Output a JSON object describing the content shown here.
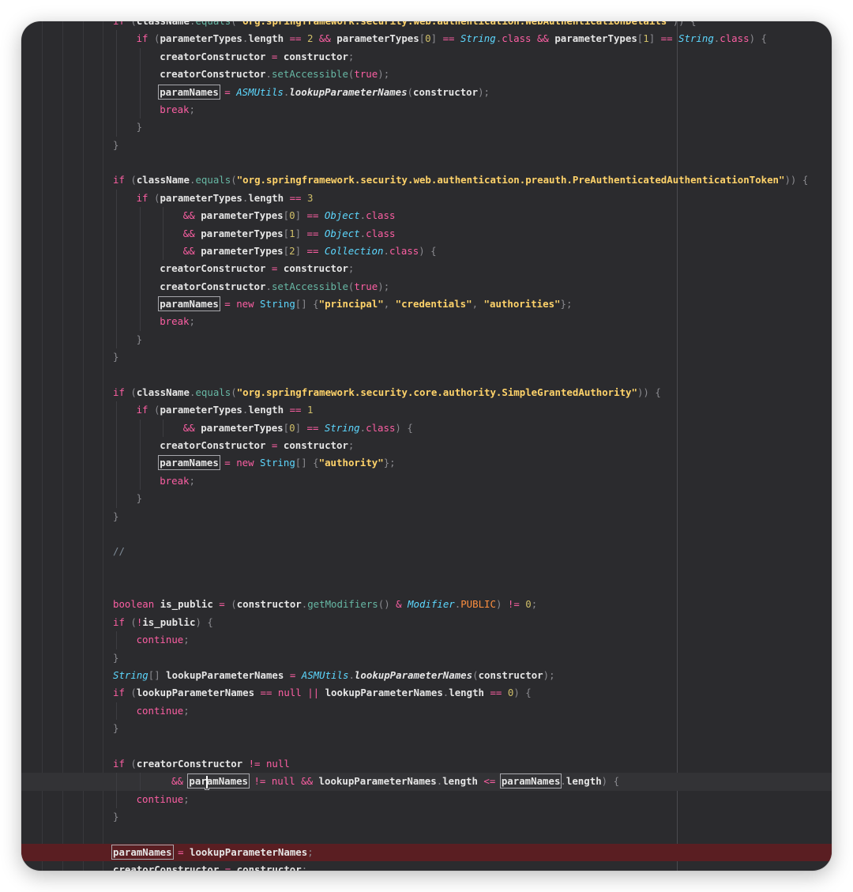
{
  "editor": {
    "colors": {
      "background": "#2b2b2e",
      "keyword": "#fc5fa3",
      "method": "#67b7a4",
      "string": "#ffd36a",
      "type": "#5dd8ff",
      "error_line": "#5a1e22"
    },
    "lines": [
      {
        "indent": 0,
        "tokens": [
          [
            "kw",
            "if"
          ],
          [
            "punct",
            " ("
          ],
          [
            "ident",
            "className"
          ],
          [
            "punct",
            "."
          ],
          [
            "fn",
            "equals"
          ],
          [
            "punct",
            "("
          ],
          [
            "strw",
            "\"org.springframework.security.web.authentication.WebAuthenticationDetails\""
          ],
          [
            "punct",
            "))"
          ],
          [
            "punct",
            " {"
          ]
        ]
      },
      {
        "indent": 1,
        "tokens": [
          [
            "kw",
            "if"
          ],
          [
            "punct",
            " ("
          ],
          [
            "ident",
            "parameterTypes"
          ],
          [
            "punct",
            "."
          ],
          [
            "ident",
            "length"
          ],
          [
            "op",
            " == "
          ],
          [
            "num",
            "2"
          ],
          [
            "op",
            " && "
          ],
          [
            "ident",
            "parameterTypes"
          ],
          [
            "punct",
            "["
          ],
          [
            "num",
            "0"
          ],
          [
            "punct",
            "]"
          ],
          [
            "op",
            " == "
          ],
          [
            "type",
            "String"
          ],
          [
            "punct",
            "."
          ],
          [
            "kw",
            "class"
          ],
          [
            "op",
            " && "
          ],
          [
            "ident",
            "parameterTypes"
          ],
          [
            "punct",
            "["
          ],
          [
            "num",
            "1"
          ],
          [
            "punct",
            "]"
          ],
          [
            "op",
            " == "
          ],
          [
            "type",
            "String"
          ],
          [
            "punct",
            "."
          ],
          [
            "kw",
            "class"
          ],
          [
            "punct",
            ") {"
          ]
        ]
      },
      {
        "indent": 2,
        "tokens": [
          [
            "ident",
            "creatorConstructor"
          ],
          [
            "op",
            " = "
          ],
          [
            "ident",
            "constructor"
          ],
          [
            "punct",
            ";"
          ]
        ]
      },
      {
        "indent": 2,
        "tokens": [
          [
            "ident",
            "creatorConstructor"
          ],
          [
            "punct",
            "."
          ],
          [
            "fn",
            "setAccessible"
          ],
          [
            "punct",
            "("
          ],
          [
            "kw",
            "true"
          ],
          [
            "punct",
            ");"
          ]
        ]
      },
      {
        "indent": 2,
        "tokens": [
          [
            "hl",
            "paramNames"
          ],
          [
            "op",
            " = "
          ],
          [
            "type",
            "ASMUtils"
          ],
          [
            "punct",
            "."
          ],
          [
            "typei",
            "lookupParameterNames"
          ],
          [
            "punct",
            "("
          ],
          [
            "ident",
            "constructor"
          ],
          [
            "punct",
            ");"
          ]
        ]
      },
      {
        "indent": 2,
        "tokens": [
          [
            "kw",
            "break"
          ],
          [
            "punct",
            ";"
          ]
        ]
      },
      {
        "indent": 1,
        "tokens": [
          [
            "punct",
            "}"
          ]
        ]
      },
      {
        "indent": 0,
        "tokens": [
          [
            "punct",
            "}"
          ]
        ]
      },
      {
        "indent": 0,
        "tokens": []
      },
      {
        "indent": 0,
        "tokens": [
          [
            "kw",
            "if"
          ],
          [
            "punct",
            " ("
          ],
          [
            "ident",
            "className"
          ],
          [
            "punct",
            "."
          ],
          [
            "fn",
            "equals"
          ],
          [
            "punct",
            "("
          ],
          [
            "strw",
            "\"org.springframework.security.web.authentication.preauth.PreAuthenticatedAuthenticationToken\""
          ],
          [
            "punct",
            "))"
          ],
          [
            "punct",
            " {"
          ]
        ]
      },
      {
        "indent": 1,
        "tokens": [
          [
            "kw",
            "if"
          ],
          [
            "punct",
            " ("
          ],
          [
            "ident",
            "parameterTypes"
          ],
          [
            "punct",
            "."
          ],
          [
            "ident",
            "length"
          ],
          [
            "op",
            " == "
          ],
          [
            "num",
            "3"
          ]
        ]
      },
      {
        "indent": 3,
        "tokens": [
          [
            "op",
            "&& "
          ],
          [
            "ident",
            "parameterTypes"
          ],
          [
            "punct",
            "["
          ],
          [
            "num",
            "0"
          ],
          [
            "punct",
            "]"
          ],
          [
            "op",
            " == "
          ],
          [
            "type",
            "Object"
          ],
          [
            "punct",
            "."
          ],
          [
            "kw",
            "class"
          ]
        ]
      },
      {
        "indent": 3,
        "tokens": [
          [
            "op",
            "&& "
          ],
          [
            "ident",
            "parameterTypes"
          ],
          [
            "punct",
            "["
          ],
          [
            "num",
            "1"
          ],
          [
            "punct",
            "]"
          ],
          [
            "op",
            " == "
          ],
          [
            "type",
            "Object"
          ],
          [
            "punct",
            "."
          ],
          [
            "kw",
            "class"
          ]
        ]
      },
      {
        "indent": 3,
        "tokens": [
          [
            "op",
            "&& "
          ],
          [
            "ident",
            "parameterTypes"
          ],
          [
            "punct",
            "["
          ],
          [
            "num",
            "2"
          ],
          [
            "punct",
            "]"
          ],
          [
            "op",
            " == "
          ],
          [
            "type",
            "Collection"
          ],
          [
            "punct",
            "."
          ],
          [
            "kw",
            "class"
          ],
          [
            "punct",
            ") {"
          ]
        ]
      },
      {
        "indent": 2,
        "tokens": [
          [
            "ident",
            "creatorConstructor"
          ],
          [
            "op",
            " = "
          ],
          [
            "ident",
            "constructor"
          ],
          [
            "punct",
            ";"
          ]
        ]
      },
      {
        "indent": 2,
        "tokens": [
          [
            "ident",
            "creatorConstructor"
          ],
          [
            "punct",
            "."
          ],
          [
            "fn",
            "setAccessible"
          ],
          [
            "punct",
            "("
          ],
          [
            "kw",
            "true"
          ],
          [
            "punct",
            ");"
          ]
        ]
      },
      {
        "indent": 2,
        "tokens": [
          [
            "hl",
            "paramNames"
          ],
          [
            "op",
            " = "
          ],
          [
            "kw",
            "new "
          ],
          [
            "typep",
            "String"
          ],
          [
            "punct",
            "[] {"
          ],
          [
            "strw",
            "\"principal\""
          ],
          [
            "punct",
            ", "
          ],
          [
            "strw",
            "\"credentials\""
          ],
          [
            "punct",
            ", "
          ],
          [
            "strw",
            "\"authorities\""
          ],
          [
            "punct",
            "};"
          ]
        ]
      },
      {
        "indent": 2,
        "tokens": [
          [
            "kw",
            "break"
          ],
          [
            "punct",
            ";"
          ]
        ]
      },
      {
        "indent": 1,
        "tokens": [
          [
            "punct",
            "}"
          ]
        ]
      },
      {
        "indent": 0,
        "tokens": [
          [
            "punct",
            "}"
          ]
        ]
      },
      {
        "indent": 0,
        "tokens": []
      },
      {
        "indent": 0,
        "tokens": [
          [
            "kw",
            "if"
          ],
          [
            "punct",
            " ("
          ],
          [
            "ident",
            "className"
          ],
          [
            "punct",
            "."
          ],
          [
            "fn",
            "equals"
          ],
          [
            "punct",
            "("
          ],
          [
            "strw",
            "\"org.springframework.security.core.authority.SimpleGrantedAuthority\""
          ],
          [
            "punct",
            "))"
          ],
          [
            "punct",
            " {"
          ]
        ]
      },
      {
        "indent": 1,
        "tokens": [
          [
            "kw",
            "if"
          ],
          [
            "punct",
            " ("
          ],
          [
            "ident",
            "parameterTypes"
          ],
          [
            "punct",
            "."
          ],
          [
            "ident",
            "length"
          ],
          [
            "op",
            " == "
          ],
          [
            "num",
            "1"
          ]
        ]
      },
      {
        "indent": 3,
        "tokens": [
          [
            "op",
            "&& "
          ],
          [
            "ident",
            "parameterTypes"
          ],
          [
            "punct",
            "["
          ],
          [
            "num",
            "0"
          ],
          [
            "punct",
            "]"
          ],
          [
            "op",
            " == "
          ],
          [
            "type",
            "String"
          ],
          [
            "punct",
            "."
          ],
          [
            "kw",
            "class"
          ],
          [
            "punct",
            ") {"
          ]
        ]
      },
      {
        "indent": 2,
        "tokens": [
          [
            "ident",
            "creatorConstructor"
          ],
          [
            "op",
            " = "
          ],
          [
            "ident",
            "constructor"
          ],
          [
            "punct",
            ";"
          ]
        ]
      },
      {
        "indent": 2,
        "tokens": [
          [
            "hl",
            "paramNames"
          ],
          [
            "op",
            " = "
          ],
          [
            "kw",
            "new "
          ],
          [
            "typep",
            "String"
          ],
          [
            "punct",
            "[] {"
          ],
          [
            "strw",
            "\"authority\""
          ],
          [
            "punct",
            "};"
          ]
        ]
      },
      {
        "indent": 2,
        "tokens": [
          [
            "kw",
            "break"
          ],
          [
            "punct",
            ";"
          ]
        ]
      },
      {
        "indent": 1,
        "tokens": [
          [
            "punct",
            "}"
          ]
        ]
      },
      {
        "indent": 0,
        "tokens": [
          [
            "punct",
            "}"
          ]
        ]
      },
      {
        "indent": 0,
        "tokens": []
      },
      {
        "indent": 0,
        "tokens": [
          [
            "comment",
            "//"
          ]
        ]
      },
      {
        "indent": 0,
        "tokens": []
      },
      {
        "indent": 0,
        "tokens": []
      },
      {
        "indent": 0,
        "tokens": [
          [
            "kw",
            "boolean "
          ],
          [
            "ident",
            "is_public"
          ],
          [
            "op",
            " = "
          ],
          [
            "punct",
            "("
          ],
          [
            "ident",
            "constructor"
          ],
          [
            "punct",
            "."
          ],
          [
            "fn",
            "getModifiers"
          ],
          [
            "punct",
            "()"
          ],
          [
            "op",
            " & "
          ],
          [
            "type",
            "Modifier"
          ],
          [
            "punct",
            "."
          ],
          [
            "const",
            "PUBLIC"
          ],
          [
            "punct",
            ")"
          ],
          [
            "op",
            " != "
          ],
          [
            "num",
            "0"
          ],
          [
            "punct",
            ";"
          ]
        ]
      },
      {
        "indent": 0,
        "tokens": [
          [
            "kw",
            "if"
          ],
          [
            "punct",
            " ("
          ],
          [
            "op",
            "!"
          ],
          [
            "ident",
            "is_public"
          ],
          [
            "punct",
            ") {"
          ]
        ]
      },
      {
        "indent": 1,
        "tokens": [
          [
            "kw",
            "continue"
          ],
          [
            "punct",
            ";"
          ]
        ]
      },
      {
        "indent": 0,
        "tokens": [
          [
            "punct",
            "}"
          ]
        ]
      },
      {
        "indent": 0,
        "tokens": [
          [
            "type",
            "String"
          ],
          [
            "punct",
            "[] "
          ],
          [
            "ident",
            "lookupParameterNames"
          ],
          [
            "op",
            " = "
          ],
          [
            "type",
            "ASMUtils"
          ],
          [
            "punct",
            "."
          ],
          [
            "typei",
            "lookupParameterNames"
          ],
          [
            "punct",
            "("
          ],
          [
            "ident",
            "constructor"
          ],
          [
            "punct",
            ");"
          ]
        ]
      },
      {
        "indent": 0,
        "tokens": [
          [
            "kw",
            "if"
          ],
          [
            "punct",
            " ("
          ],
          [
            "ident",
            "lookupParameterNames"
          ],
          [
            "op",
            " == "
          ],
          [
            "kw",
            "null"
          ],
          [
            "op",
            " || "
          ],
          [
            "ident",
            "lookupParameterNames"
          ],
          [
            "punct",
            "."
          ],
          [
            "ident",
            "length"
          ],
          [
            "op",
            " == "
          ],
          [
            "num",
            "0"
          ],
          [
            "punct",
            ") {"
          ]
        ]
      },
      {
        "indent": 1,
        "tokens": [
          [
            "kw",
            "continue"
          ],
          [
            "punct",
            ";"
          ]
        ]
      },
      {
        "indent": 0,
        "tokens": [
          [
            "punct",
            "}"
          ]
        ]
      },
      {
        "indent": 0,
        "tokens": []
      },
      {
        "indent": 0,
        "tokens": [
          [
            "kw",
            "if"
          ],
          [
            "punct",
            " ("
          ],
          [
            "ident",
            "creatorConstructor"
          ],
          [
            "op",
            " != "
          ],
          [
            "kw",
            "null"
          ]
        ]
      },
      {
        "indent": 2.5,
        "current": true,
        "tokens": [
          [
            "op",
            "&& "
          ],
          [
            "hlcaret",
            "paramNames"
          ],
          [
            "op",
            " != "
          ],
          [
            "kw",
            "null"
          ],
          [
            "op",
            " && "
          ],
          [
            "ident",
            "lookupParameterNames"
          ],
          [
            "punct",
            "."
          ],
          [
            "ident",
            "length"
          ],
          [
            "op",
            " <= "
          ],
          [
            "hl",
            "paramNames"
          ],
          [
            "punct",
            "."
          ],
          [
            "ident",
            "length"
          ],
          [
            "punct",
            ") {"
          ]
        ]
      },
      {
        "indent": 1,
        "tokens": [
          [
            "kw",
            "continue"
          ],
          [
            "punct",
            ";"
          ]
        ]
      },
      {
        "indent": 0,
        "tokens": [
          [
            "punct",
            "}"
          ]
        ]
      },
      {
        "indent": 0,
        "tokens": []
      },
      {
        "indent": 0,
        "error": true,
        "tokens": [
          [
            "hl",
            "paramNames"
          ],
          [
            "op",
            " = "
          ],
          [
            "ident",
            "lookupParameterNames"
          ],
          [
            "punct",
            ";"
          ]
        ]
      },
      {
        "indent": 0,
        "tokens": [
          [
            "ident",
            "creatorConstructor"
          ],
          [
            "op",
            " = "
          ],
          [
            "ident",
            "constructor"
          ],
          [
            "punct",
            ";"
          ]
        ]
      }
    ]
  }
}
